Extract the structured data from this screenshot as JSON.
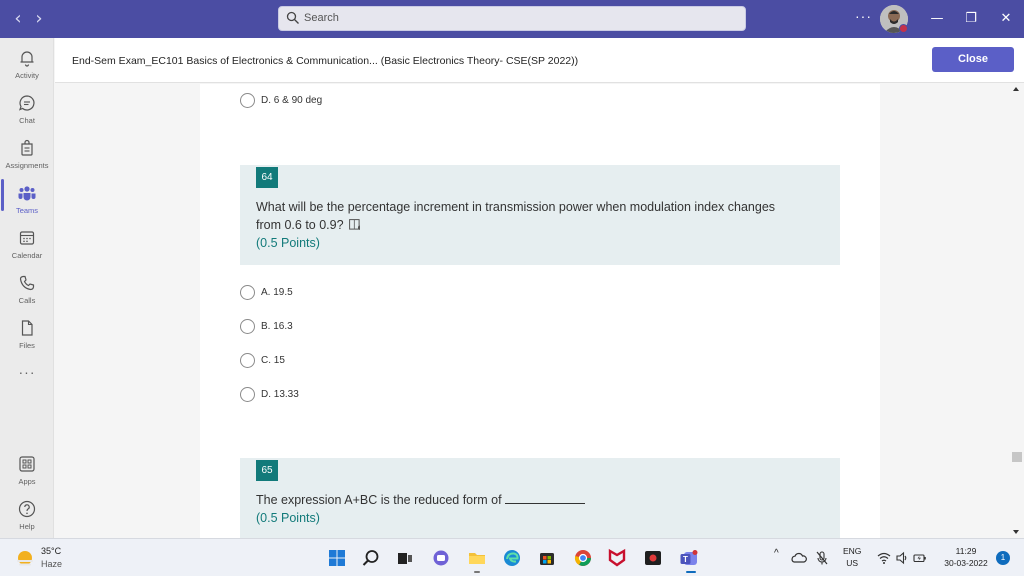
{
  "titlebar": {
    "back": "‹",
    "forward": "›",
    "search_placeholder": "Search",
    "more": "···",
    "minimize": "—",
    "maximize": "❐",
    "close": "✕"
  },
  "rail": {
    "items": [
      {
        "label": "Activity",
        "icon": "bell-icon"
      },
      {
        "label": "Chat",
        "icon": "chat-icon"
      },
      {
        "label": "Assignments",
        "icon": "assignments-icon"
      },
      {
        "label": "Teams",
        "icon": "teams-icon"
      },
      {
        "label": "Calendar",
        "icon": "calendar-icon"
      },
      {
        "label": "Calls",
        "icon": "phone-icon"
      },
      {
        "label": "Files",
        "icon": "file-icon"
      },
      {
        "label": "Apps",
        "icon": "apps-icon"
      },
      {
        "label": "Help",
        "icon": "help-icon"
      }
    ],
    "more": "···"
  },
  "header": {
    "title": "End-Sem Exam_EC101 Basics of Electronics & Communication... (Basic Electronics Theory- CSE(SP 2022))",
    "close_label": "Close"
  },
  "form": {
    "prev_option": "D. 6 & 90 deg",
    "questions": [
      {
        "number": "64",
        "text_line1": "What will be the percentage increment in transmission power when modulation index changes",
        "text_line2": "from 0.6 to 0.9?",
        "points": "(0.5 Points)",
        "options": [
          "A. 19.5",
          "B. 16.3",
          "C. 15",
          "D. 13.33"
        ]
      },
      {
        "number": "65",
        "text": "The expression A+BC is the reduced form of",
        "points": "(0.5 Points)"
      }
    ]
  },
  "taskbar": {
    "weather_temp": "35°C",
    "weather_desc": "Haze",
    "lang_line1": "ENG",
    "lang_line2": "US",
    "time": "11:29",
    "date": "30-03-2022",
    "notifications": "1",
    "tray_chevron": "^"
  },
  "colors": {
    "titlebar": "#4b4da3",
    "accent": "#5b5fc7",
    "question_badge": "#127a7a",
    "question_bg": "#e6eef0"
  }
}
